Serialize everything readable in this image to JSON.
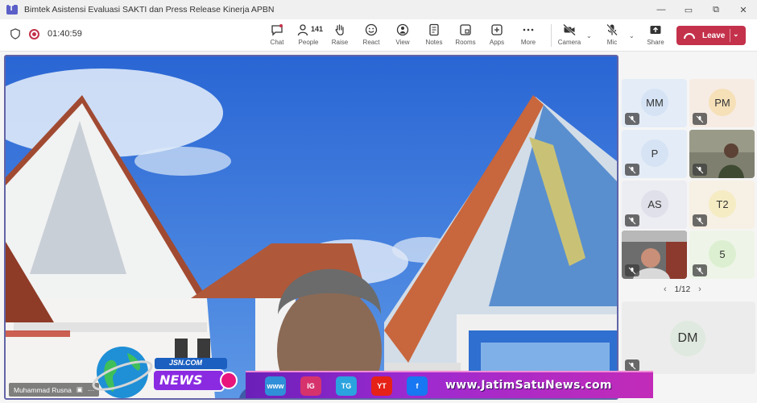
{
  "window": {
    "title": "Bimtek Asistensi Evaluasi SAKTI dan Press Release Kinerja APBN",
    "controls": [
      "—",
      "▭",
      "⧉",
      "✕"
    ]
  },
  "toolbar": {
    "timer": "01:40:59",
    "people_count": "141",
    "tools": [
      {
        "label": "Chat",
        "icon": "chat-icon"
      },
      {
        "label": "People",
        "icon": "people-icon"
      },
      {
        "label": "Raise",
        "icon": "hand-icon"
      },
      {
        "label": "React",
        "icon": "smile-icon"
      },
      {
        "label": "View",
        "icon": "view-icon"
      },
      {
        "label": "Notes",
        "icon": "notes-icon"
      },
      {
        "label": "Rooms",
        "icon": "rooms-icon"
      },
      {
        "label": "Apps",
        "icon": "apps-icon"
      },
      {
        "label": "More",
        "icon": "more-icon"
      },
      {
        "label": "Camera",
        "icon": "camera-off-icon"
      },
      {
        "label": "Mic",
        "icon": "mic-off-icon"
      },
      {
        "label": "Share",
        "icon": "share-icon"
      }
    ],
    "leave_label": "Leave",
    "accent": "#c4314b"
  },
  "stage": {
    "speaker_name": "Muhammad Rusna"
  },
  "watermark": {
    "brand_top": "JSN.COM",
    "brand_main": "NEWS",
    "site": "www.JatimSatuNews.com",
    "social": [
      {
        "label": "www",
        "color": "#2f8fd8"
      },
      {
        "label": "IG",
        "color": "#d6336c"
      },
      {
        "label": "TG",
        "color": "#2aa3df"
      },
      {
        "label": "YT",
        "color": "#e62117"
      },
      {
        "label": "f",
        "color": "#1877f2"
      }
    ]
  },
  "participants": {
    "tiles": [
      {
        "initials": "MM",
        "bg": "#e4ecf7",
        "avatar_bg": "#d5e3f5",
        "video": false
      },
      {
        "initials": "PM",
        "bg": "#f7ece4",
        "avatar_bg": "#f5e0b8",
        "video": false
      },
      {
        "initials": "P",
        "bg": "#e4ecf7",
        "avatar_bg": "#d5e3f5",
        "video": false
      },
      {
        "initials": "",
        "bg": "#8a8a7a",
        "avatar_bg": "",
        "video": true
      },
      {
        "initials": "AS",
        "bg": "#ececf3",
        "avatar_bg": "#e0e0ea",
        "video": false
      },
      {
        "initials": "T2",
        "bg": "#f7f0e4",
        "avatar_bg": "#f5ecc4",
        "video": false
      },
      {
        "initials": "",
        "bg": "#6a6a6a",
        "avatar_bg": "",
        "video": true
      },
      {
        "initials": "5",
        "bg": "#eef5e8",
        "avatar_bg": "#dcefd0",
        "video": false
      }
    ],
    "page": "1/12",
    "featured": {
      "initials": "DM"
    }
  }
}
